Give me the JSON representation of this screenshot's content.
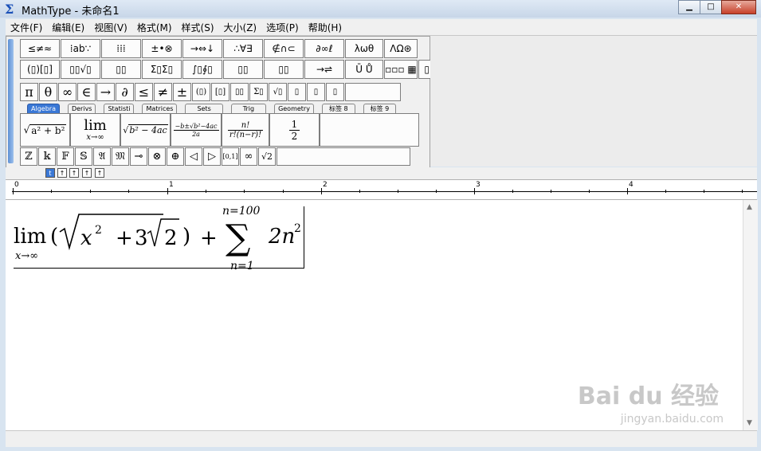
{
  "window": {
    "title": "MathType - 未命名1",
    "minimize": "▁",
    "maximize": "□",
    "close": "✕"
  },
  "menu": [
    "文件(F)",
    "编辑(E)",
    "视图(V)",
    "格式(M)",
    "样式(S)",
    "大小(Z)",
    "选项(P)",
    "帮助(H)"
  ],
  "symbol_palettes_row1": [
    "≤≠≈",
    "⁞ab∵",
    "⁞⁞⁞",
    "±•⊗",
    "→⇔↓",
    "∴∀∃",
    "∉∩⊂",
    "∂∞ℓ",
    "λωθ",
    "ΛΩ⊛"
  ],
  "symbol_palettes_row1b": [
    "(▯)[▯]",
    "▯▯√▯",
    "▯▯",
    "Σ▯Σ▯",
    "∫▯∮▯",
    "▯▯",
    "▯▯",
    "→⇌",
    "Ū Ů",
    "▫▫▫ ▦",
    "▯▯"
  ],
  "quick_symbols": [
    "π",
    "θ",
    "∞",
    "∈",
    "→",
    "∂",
    "≤",
    "≠",
    "±",
    "(▯)",
    "[▯]",
    "▯▯",
    "Σ▯",
    "√▯",
    "▯",
    "▯",
    "▯"
  ],
  "tabs": [
    "Algebra",
    "Derivs",
    "Statisti",
    "Matrices",
    "Sets",
    "Trig",
    "Geometry",
    "标签 8",
    "标签 9"
  ],
  "active_tab": "Algebra",
  "templates": [
    "√(a²+b²)",
    "lim x→∞",
    "√(b²−4ac)",
    "(−b±√(b²−4ac))/2a",
    "n!/(r!(n−r)!)",
    "1/2"
  ],
  "template_labels": {
    "sqrt_ab": "a² + b²",
    "lim": "lim",
    "lim_sub": "x→∞",
    "sqrt_disc": "b² − 4ac",
    "quad_top": "−b±√b²−4ac",
    "quad_bot": "2a",
    "binom_top": "n!",
    "binom_bot": "r!(n−r)!",
    "half_top": "1",
    "half_bot": "2"
  },
  "bottom_row": [
    "ℤ",
    "𝕜",
    "𝔽",
    "𝕊",
    "𝔄",
    "𝔐",
    "⊸",
    "⊗",
    "⊕",
    "◁",
    "▷",
    "[0,1]",
    "∞",
    "√2"
  ],
  "mini_buttons": [
    "t",
    "↑",
    "↑",
    "↑",
    "↑"
  ],
  "ruler": [
    "0",
    "1",
    "2",
    "3",
    "4"
  ],
  "equation": {
    "lim": "lim",
    "lim_sub": "x→∞",
    "open": "(",
    "x": "x",
    "x_exp": "2",
    "plus1": "+",
    "three": "3",
    "two": "2",
    "close": ")",
    "plus2": "+",
    "sigma": "∑",
    "sigma_top": "n=100",
    "sigma_bot": "n=1",
    "term": "2n",
    "term_exp": "2"
  },
  "watermark": "Bai du 经验",
  "watermark_sub": "jingyan.baidu.com"
}
